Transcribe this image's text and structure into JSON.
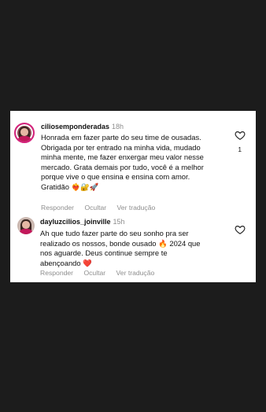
{
  "comments": [
    {
      "username": "ciliosemponderadas",
      "time": "18h",
      "text": "Honrada em fazer parte do seu time de ousadas.\nObrigada por ter entrado na minha vida, mudado\nminha mente, me fazer enxergar meu valor nesse\nmercado. Grata demais por tudo, você é a melhor\nporque vive o que ensina e ensina com amor.\nGratidão ❤️‍🔥🔐🚀",
      "like_count": "1",
      "actions": {
        "reply": "Responder",
        "hide": "Ocultar",
        "translate": "Ver tradução"
      }
    },
    {
      "username": "dayluzcilios_joinville",
      "time": "15h",
      "text": "Ah que tudo fazer parte do seu sonho pra ser\nrealizado os nossos, bonde ousado 🔥 2024 que\nnos aguarde. Deus continue sempre te\nabençoando ❤️",
      "actions": {
        "reply": "Responder",
        "hide": "Ocultar",
        "translate": "Ver tradução"
      }
    }
  ],
  "icons": {
    "like": "heart-outline-icon"
  },
  "colors": {
    "background": "#1c1c1c",
    "card": "#ffffff",
    "muted": "#8e8e8e",
    "story_ring": "#d4237c"
  }
}
